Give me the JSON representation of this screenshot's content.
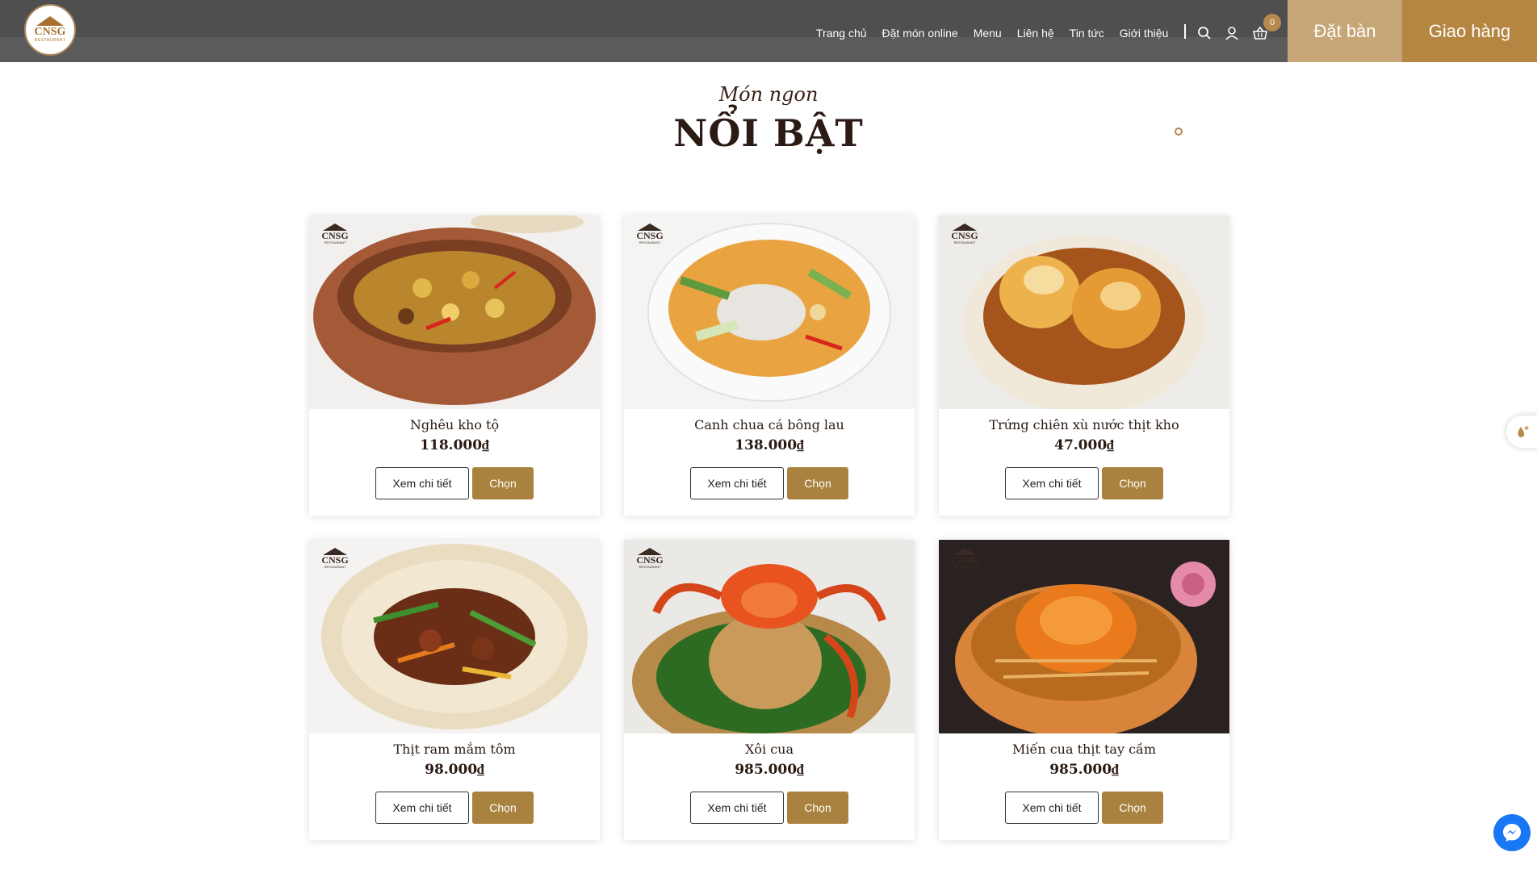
{
  "brand": {
    "logo_text": "CNSG",
    "logo_sub": "RESTAURANT"
  },
  "nav": {
    "items": [
      {
        "label": "Trang chủ"
      },
      {
        "label": "Đặt món online"
      },
      {
        "label": "Menu"
      },
      {
        "label": "Liên hệ"
      },
      {
        "label": "Tin tức"
      },
      {
        "label": "Giới thiệu"
      }
    ],
    "cart_count": "0",
    "icons": [
      "search-icon",
      "user-icon",
      "basket-icon"
    ]
  },
  "cta": {
    "book_table": "Đặt bàn",
    "delivery": "Giao hàng"
  },
  "section": {
    "subtitle": "Món ngon",
    "title": "NỔI BẬT"
  },
  "products": [
    {
      "name": "Nghêu kho tộ",
      "price": "118.000₫",
      "detail_label": "Xem chi tiết",
      "choose_label": "Chọn"
    },
    {
      "name": "Canh chua cá bông lau",
      "price": "138.000₫",
      "detail_label": "Xem chi tiết",
      "choose_label": "Chọn"
    },
    {
      "name": "Trứng chiên xù nước thịt kho",
      "price": "47.000₫",
      "detail_label": "Xem chi tiết",
      "choose_label": "Chọn"
    },
    {
      "name": "Thịt ram mắm tôm",
      "price": "98.000₫",
      "detail_label": "Xem chi tiết",
      "choose_label": "Chọn"
    },
    {
      "name": "Xôi cua",
      "price": "985.000₫",
      "detail_label": "Xem chi tiết",
      "choose_label": "Chọn"
    },
    {
      "name": "Miến cua thịt tay cầm",
      "price": "985.000₫",
      "detail_label": "Xem chi tiết",
      "choose_label": "Chọn"
    }
  ],
  "badge": {
    "text": "CNSG",
    "sub": "RESTAURANT"
  },
  "colors": {
    "header": "#5b5b5b",
    "gold": "#b58641",
    "gold_light": "#c6a676",
    "button": "#a9823f"
  }
}
